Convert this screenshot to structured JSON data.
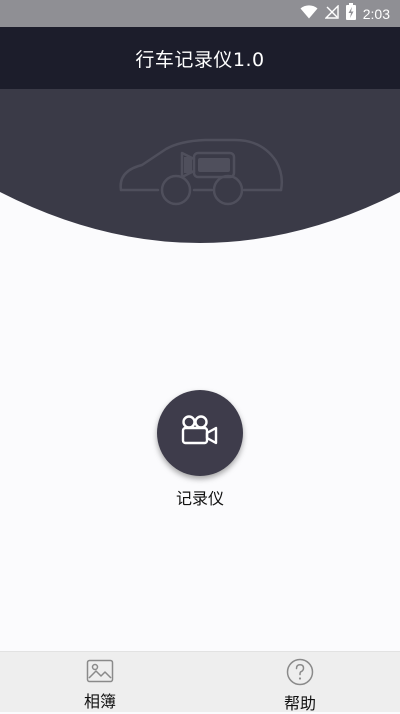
{
  "status_bar": {
    "time": "2:03",
    "icons": [
      "wifi-icon",
      "no-signal-icon",
      "battery-charging-icon"
    ]
  },
  "header": {
    "title": "行车记录仪1.0"
  },
  "hero": {
    "illustration": "car-camera-icon"
  },
  "main": {
    "record_button_label": "记录仪",
    "record_icon": "video-camera-icon"
  },
  "bottom_nav": {
    "items": [
      {
        "label": "相簿",
        "icon": "image-icon"
      },
      {
        "label": "帮助",
        "icon": "help-circle-icon"
      }
    ]
  },
  "colors": {
    "header_bg": "#1c1d2b",
    "hero_bg": "#3a3a47",
    "status_bar_bg": "#8f8f94",
    "record_button_bg": "#3e3c4b",
    "nav_bg": "#eeeeee"
  }
}
